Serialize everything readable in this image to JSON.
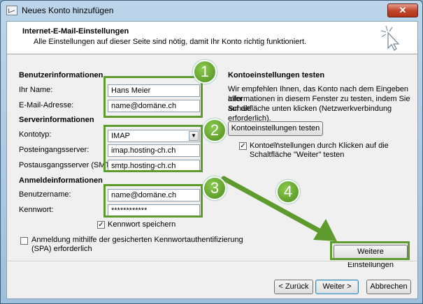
{
  "window": {
    "title": "Neues Konto hinzufügen",
    "close_glyph": "✕"
  },
  "header": {
    "title": "Internet-E-Mail-Einstellungen",
    "subtitle": "Alle Einstellungen auf dieser Seite sind nötig, damit Ihr Konto richtig funktioniert."
  },
  "user_info": {
    "heading": "Benutzerinformationen",
    "name_label": "Ihr Name:",
    "name_value": "Hans Meier",
    "email_label": "E-Mail-Adresse:",
    "email_value": "name@domäne.ch"
  },
  "server_info": {
    "heading": "Serverinformationen",
    "account_type_label": "Kontotyp:",
    "account_type_value": "IMAP",
    "incoming_label": "Posteingangsserver:",
    "incoming_value": "imap.hosting-ch.ch",
    "outgoing_label": "Postausgangsserver (SMTP):",
    "outgoing_value": "smtp.hosting-ch.ch"
  },
  "login_info": {
    "heading": "Anmeldeinformationen",
    "username_label": "Benutzername:",
    "username_value": "name@domäne.ch",
    "password_label": "Kennwort:",
    "password_value": "************",
    "remember_label": "Kennwort speichern",
    "remember_checked": "✓",
    "spa_label_1": "Anmeldung mithilfe der gesicherten Kennwortauthentifizierung",
    "spa_label_2": "(SPA) erforderlich"
  },
  "test": {
    "heading": "Kontoeinstellungen testen",
    "desc_1": "Wir empfehlen Ihnen, das Konto nach dem Eingeben aller",
    "desc_2": "Informationen in diesem Fenster zu testen, indem Sie auf die",
    "desc_3": "Schaltfläche unten klicken (Netzwerkverbindung erforderlich).",
    "button_label": "Kontoeinstellungen testen ...",
    "auto_test_label_1": "Kontoeinstellungen durch Klicken auf die",
    "auto_test_label_2": "Schaltfläche \"Weiter\" testen",
    "auto_test_checked": "✓"
  },
  "more_settings_label": "Weitere Einstellungen",
  "footer": {
    "back_label": "< Zurück",
    "next_label": "Weiter >",
    "cancel_label": "Abbrechen"
  },
  "callouts": [
    "1",
    "2",
    "3",
    "4"
  ],
  "colors": {
    "highlight": "#5e9b2d",
    "badge": "#6aae30"
  }
}
